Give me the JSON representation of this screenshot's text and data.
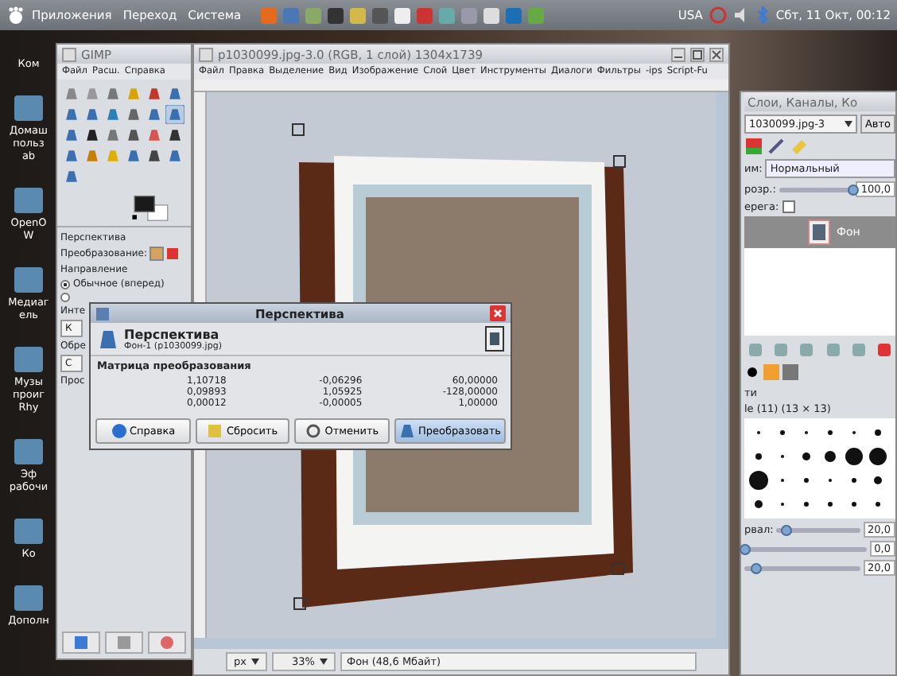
{
  "top_panel": {
    "menus": [
      "Приложения",
      "Переход",
      "Система"
    ],
    "keyboard": "USA",
    "clock": "Сбт, 11 Окт, 00:12"
  },
  "desktop_icons": [
    {
      "lines": [
        "Ком"
      ]
    },
    {
      "lines": [
        "Домаш",
        "польз",
        "ab"
      ]
    },
    {
      "lines": [
        "OpenO",
        "W"
      ]
    },
    {
      "lines": [
        "Медиаг",
        "ель"
      ]
    },
    {
      "lines": [
        "Музы",
        "проиг",
        "Rhy"
      ]
    },
    {
      "lines": [
        "Эф",
        "рабочи"
      ]
    },
    {
      "lines": [
        "Ко"
      ]
    },
    {
      "lines": [
        "Дополн"
      ]
    }
  ],
  "toolbox": {
    "title": "GIMP",
    "menu": [
      "Файл",
      "Расш.",
      "Справка"
    ],
    "tools": [
      {
        "selected": false
      },
      {
        "selected": false
      },
      {
        "selected": false
      },
      {
        "selected": false
      },
      {
        "selected": false
      },
      {
        "selected": false
      },
      {
        "selected": false
      },
      {
        "selected": false
      },
      {
        "selected": false
      },
      {
        "selected": false
      },
      {
        "selected": false
      },
      {
        "selected": true
      },
      {
        "selected": false
      },
      {
        "selected": false
      },
      {
        "selected": false
      },
      {
        "selected": false
      },
      {
        "selected": false
      },
      {
        "selected": false
      },
      {
        "selected": false
      },
      {
        "selected": false
      },
      {
        "selected": false
      },
      {
        "selected": false
      },
      {
        "selected": false
      },
      {
        "selected": false
      },
      {
        "selected": false
      }
    ],
    "options_title": "Перспектива",
    "transform_label": "Преобразование:",
    "direction_label": "Направление",
    "direction_options": [
      {
        "label": "Обычное (вперед)",
        "selected": true
      },
      {
        "selected": false
      }
    ],
    "cut_labels": [
      "Инте",
      "Обре",
      "Прос"
    ],
    "cut_fields": [
      "К",
      "С"
    ]
  },
  "image_window": {
    "title": "p1030099.jpg-3.0 (RGB, 1 слой) 1304x1739",
    "menu": [
      "Файл",
      "Правка",
      "Выделение",
      "Вид",
      "Изображение",
      "Слой",
      "Цвет",
      "Инструменты",
      "Диалоги",
      "Фильтры",
      "-ips",
      "Script-Fu"
    ],
    "unit": "px",
    "zoom": "33%",
    "status": "Фон (48,6 Мбайт)"
  },
  "dialog": {
    "title": "Перспектива",
    "heading": "Перспектива",
    "subheading": "Фон-1 (p1030099.jpg)",
    "matrix_label": "Матрица преобразования",
    "matrix": [
      [
        "1,10718",
        "-0,06296",
        "60,00000"
      ],
      [
        "0,09893",
        "1,05925",
        "-128,00000"
      ],
      [
        "0,00012",
        "-0,00005",
        "1,00000"
      ]
    ],
    "buttons": [
      "Справка",
      "Сбросить",
      "Отменить",
      "Преобразовать"
    ]
  },
  "layers_dock": {
    "title": "Слои, Каналы, Ко",
    "image": "1030099.jpg-3",
    "auto_button": "Авто",
    "mode_label": "им:",
    "mode": "Нормальный",
    "opacity_label": "розр.:",
    "opacity": {
      "value": "100,0",
      "level": 1
    },
    "lock": {
      "label": "ерега:",
      "checked": false
    },
    "layers": [
      {
        "name": "Фон",
        "selected": true
      }
    ],
    "brushes_header": "ти",
    "brush_name": "le (11) (13 × 13)",
    "spacing_label": "рвал:",
    "spacing": {
      "value": "20,0",
      "level": 0.1
    },
    "bottom_values": [
      {
        "value": "0,0",
        "level": 0
      },
      {
        "value": "20,0",
        "level": 0.1
      }
    ]
  }
}
